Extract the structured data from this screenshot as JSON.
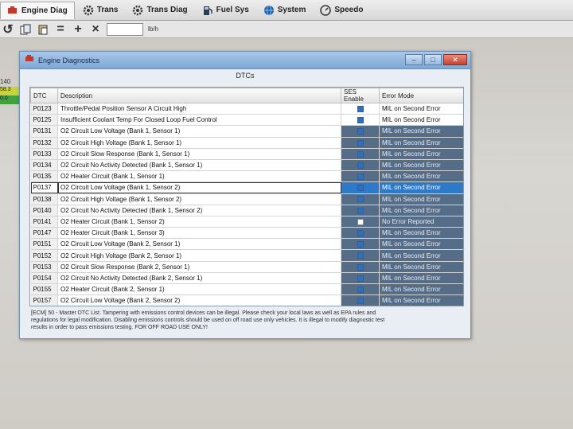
{
  "tabs": [
    {
      "label": "Engine Diag",
      "icon": "engine-icon"
    },
    {
      "label": "Trans",
      "icon": "gear-icon"
    },
    {
      "label": "Trans Diag",
      "icon": "gear-icon"
    },
    {
      "label": "Fuel Sys",
      "icon": "fuel-pump-icon"
    },
    {
      "label": "System",
      "icon": "globe-icon"
    },
    {
      "label": "Speedo",
      "icon": "speedometer-icon"
    }
  ],
  "toolbar": {
    "unit": "lb/h",
    "input_value": ""
  },
  "background_strip": {
    "label": "140",
    "cell1": "58.3",
    "cell2": "0.0"
  },
  "window": {
    "title": "Engine Diagnostics",
    "panel_title": "DTCs",
    "columns": [
      "DTC",
      "Description",
      "SES Enable",
      "Error Mode"
    ],
    "rows": [
      {
        "code": "P0123",
        "desc": "Throttle/Pedal Position Sensor A Circuit High",
        "ses": true,
        "mode": "MIL on Second Error",
        "dark": false
      },
      {
        "code": "P0125",
        "desc": "Insufficient Coolant Temp For Closed Loop Fuel Control",
        "ses": true,
        "mode": "MIL on Second Error",
        "dark": false
      },
      {
        "code": "P0131",
        "desc": "O2 Circuit Low Voltage (Bank 1, Sensor 1)",
        "ses": true,
        "mode": "MIL on Second Error",
        "dark": true
      },
      {
        "code": "P0132",
        "desc": "O2 Circuit High Voltage (Bank 1, Sensor 1)",
        "ses": true,
        "mode": "MIL on Second Error",
        "dark": true
      },
      {
        "code": "P0133",
        "desc": "O2 Circuit Slow Response (Bank 1, Sensor 1)",
        "ses": true,
        "mode": "MIL on Second Error",
        "dark": true
      },
      {
        "code": "P0134",
        "desc": "O2 Circuit No Activity Detected (Bank 1, Sensor 1)",
        "ses": true,
        "mode": "MIL on Second Error",
        "dark": true
      },
      {
        "code": "P0135",
        "desc": "O2 Heater Circuit (Bank 1, Sensor 1)",
        "ses": true,
        "mode": "MIL on Second Error",
        "dark": true
      },
      {
        "code": "P0137",
        "desc": "O2 Circuit Low Voltage (Bank 1, Sensor 2)",
        "ses": true,
        "mode": "MIL on Second Error",
        "dark": false,
        "selected": true
      },
      {
        "code": "P0138",
        "desc": "O2 Circuit High Voltage (Bank 1, Sensor 2)",
        "ses": true,
        "mode": "MIL on Second Error",
        "dark": true
      },
      {
        "code": "P0140",
        "desc": "O2 Circuit No Activity Detected (Bank 1, Sensor 2)",
        "ses": true,
        "mode": "MIL on Second Error",
        "dark": true
      },
      {
        "code": "P0141",
        "desc": "O2 Heater Circuit (Bank 1, Sensor 2)",
        "ses": false,
        "mode": "No Error Reported",
        "dark": true
      },
      {
        "code": "P0147",
        "desc": "O2 Heater Circuit (Bank 1, Sensor 3)",
        "ses": true,
        "mode": "MIL on Second Error",
        "dark": true
      },
      {
        "code": "P0151",
        "desc": "O2 Circuit Low Voltage (Bank 2, Sensor 1)",
        "ses": true,
        "mode": "MIL on Second Error",
        "dark": true
      },
      {
        "code": "P0152",
        "desc": "O2 Circuit High Voltage (Bank 2, Sensor 1)",
        "ses": true,
        "mode": "MIL on Second Error",
        "dark": true
      },
      {
        "code": "P0153",
        "desc": "O2 Circuit Slow Response (Bank 2, Sensor 1)",
        "ses": true,
        "mode": "MIL on Second Error",
        "dark": true
      },
      {
        "code": "P0154",
        "desc": "O2 Circuit No Activity Detected (Bank 2, Sensor 1)",
        "ses": true,
        "mode": "MIL on Second Error",
        "dark": true
      },
      {
        "code": "P0155",
        "desc": "O2 Heater Circuit (Bank 2, Sensor 1)",
        "ses": true,
        "mode": "MIL on Second Error",
        "dark": true
      },
      {
        "code": "P0157",
        "desc": "O2 Circuit Low Voltage (Bank 2, Sensor 2)",
        "ses": true,
        "mode": "MIL on Second Error",
        "dark": true
      }
    ],
    "footer_line1": "[ECM] 50 - Master DTC List. Tampering with emissions control devices can be illegal. Please check your local laws as well as EPA rules and",
    "footer_line2": "regulations for legal modification. Disabling emissions controls should be used on off road use only vehicles. It is illegal to modify diagnostic test",
    "footer_line3": "results in order to pass emissions testing. FOR OFF ROAD USE ONLY!"
  },
  "colors": {
    "accent": "#2f79c9",
    "titlebar": "#7ea8d6",
    "dark_cell": "#566d88"
  }
}
